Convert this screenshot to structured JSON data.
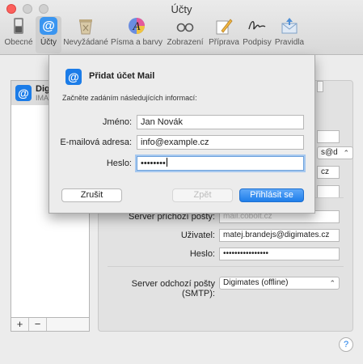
{
  "window": {
    "title": "Účty"
  },
  "toolbar": {
    "items": [
      {
        "label": "Obecné",
        "icon": "general-switch-icon"
      },
      {
        "label": "Účty",
        "icon": "at-sign-icon"
      },
      {
        "label": "Nevyžádané",
        "icon": "junk-trash-icon"
      },
      {
        "label": "Písma a barvy",
        "icon": "fonts-colors-icon"
      },
      {
        "label": "Zobrazení",
        "icon": "glasses-icon"
      },
      {
        "label": "Příprava",
        "icon": "compose-pencil-icon"
      },
      {
        "label": "Podpisy",
        "icon": "signature-icon"
      },
      {
        "label": "Pravidla",
        "icon": "rules-envelope-icon"
      }
    ]
  },
  "accounts": {
    "items": [
      {
        "name": "Dig",
        "type": "IMA"
      }
    ],
    "add_label": "+",
    "remove_label": "−"
  },
  "detail": {
    "partial_values": [
      "s@d",
      "cz"
    ],
    "incoming_server_label": "Server příchozí pošty:",
    "incoming_server_value": "mail.cobolt.cz",
    "user_label": "Uživatel:",
    "user_value": "matej.brandejs@digimates.cz",
    "password_label": "Heslo:",
    "password_value": "••••••••••••••••",
    "smtp_label": "Server odchozí pošty (SMTP):",
    "smtp_value": "Digimates (offline)",
    "help_label": "?"
  },
  "sheet": {
    "icon": "at-sign-icon",
    "title": "Přidat účet Mail",
    "subtitle": "Začněte zadáním následujících informací:",
    "name_label": "Jméno:",
    "name_value": "Jan Novák",
    "email_label": "E-mailová adresa:",
    "email_value": "info@example.cz",
    "password_label": "Heslo:",
    "password_value": "••••••••",
    "cancel_label": "Zrušit",
    "back_label": "Zpět",
    "login_label": "Přihlásit se"
  },
  "colors": {
    "accent": "#1b7ce8",
    "close": "#fc605c"
  }
}
